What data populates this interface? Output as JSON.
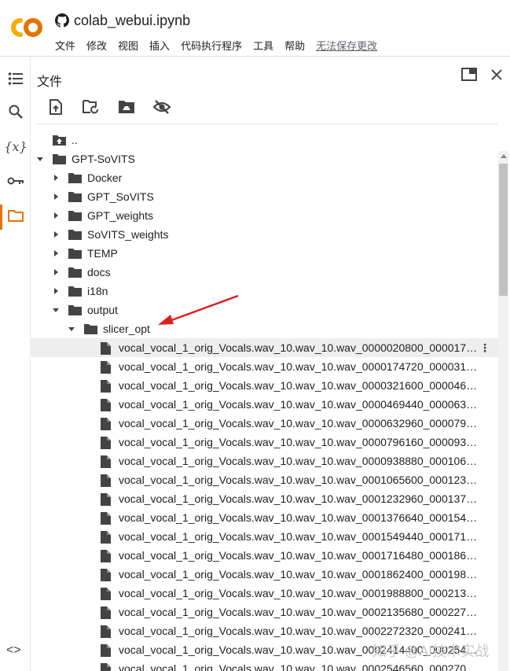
{
  "colors": {
    "accent": "#e8710a",
    "logo_orange": "#f9ab00",
    "logo_dark": "#e37400",
    "selected_row": "#eeeeee",
    "arrow": "#e02020"
  },
  "header": {
    "logo": "CO",
    "notebook_title": "colab_webui.ipynb",
    "menu": [
      "文件",
      "修改",
      "视图",
      "插入",
      "代码执行程序",
      "工具",
      "帮助"
    ],
    "unsaved_label": "无法保存更改"
  },
  "rail": {
    "icons": [
      "list-icon",
      "search-icon",
      "variables-icon",
      "key-icon",
      "folder-icon"
    ],
    "variables_glyph": "{x}",
    "code_toggle": "<>"
  },
  "panel": {
    "title": "文件",
    "toolbar": [
      "upload-icon",
      "refresh-icon",
      "drive-icon",
      "hide-icon"
    ]
  },
  "tree": {
    "parent": "..",
    "root": "GPT-SoVITS",
    "folders": [
      "Docker",
      "GPT_SoVITS",
      "GPT_weights",
      "SoVITS_weights",
      "TEMP",
      "docs",
      "i18n"
    ],
    "output": "output",
    "slicer": "slicer_opt",
    "files": [
      "vocal_vocal_1_orig_Vocals.wav_10.wav_10.wav_0000020800_00001747...",
      "vocal_vocal_1_orig_Vocals.wav_10.wav_10.wav_0000174720_00003193...",
      "vocal_vocal_1_orig_Vocals.wav_10.wav_10.wav_0000321600_00004678...",
      "vocal_vocal_1_orig_Vocals.wav_10.wav_10.wav_0000469440_00006329...",
      "vocal_vocal_1_orig_Vocals.wav_10.wav_10.wav_0000632960_00007961...",
      "vocal_vocal_1_orig_Vocals.wav_10.wav_10.wav_0000796160_00009388...",
      "vocal_vocal_1_orig_Vocals.wav_10.wav_10.wav_0000938880_00010656...",
      "vocal_vocal_1_orig_Vocals.wav_10.wav_10.wav_0001065600_00012329...",
      "vocal_vocal_1_orig_Vocals.wav_10.wav_10.wav_0001232960_00013744...",
      "vocal_vocal_1_orig_Vocals.wav_10.wav_10.wav_0001376640_00015494...",
      "vocal_vocal_1_orig_Vocals.wav_10.wav_10.wav_0001549440_00017164...",
      "vocal_vocal_1_orig_Vocals.wav_10.wav_10.wav_0001716480_00018624...",
      "vocal_vocal_1_orig_Vocals.wav_10.wav_10.wav_0001862400_00019888...",
      "vocal_vocal_1_orig_Vocals.wav_10.wav_10.wav_0001988800_00021356...",
      "vocal_vocal_1_orig_Vocals.wav_10.wav_10.wav_0002135680_00022723...",
      "vocal_vocal_1_orig_Vocals.wav_10.wav_10.wav_0002272320_00024144...",
      "vocal_vocal_1_orig_Vocals.wav_10.wav_10.wav_0002414400_00025465...",
      "vocal_vocal_1_orig_Vocals.wav_10.wav_10.wav_0002546560_00027036..."
    ]
  },
  "watermark": "知乎 @AI技术实战"
}
